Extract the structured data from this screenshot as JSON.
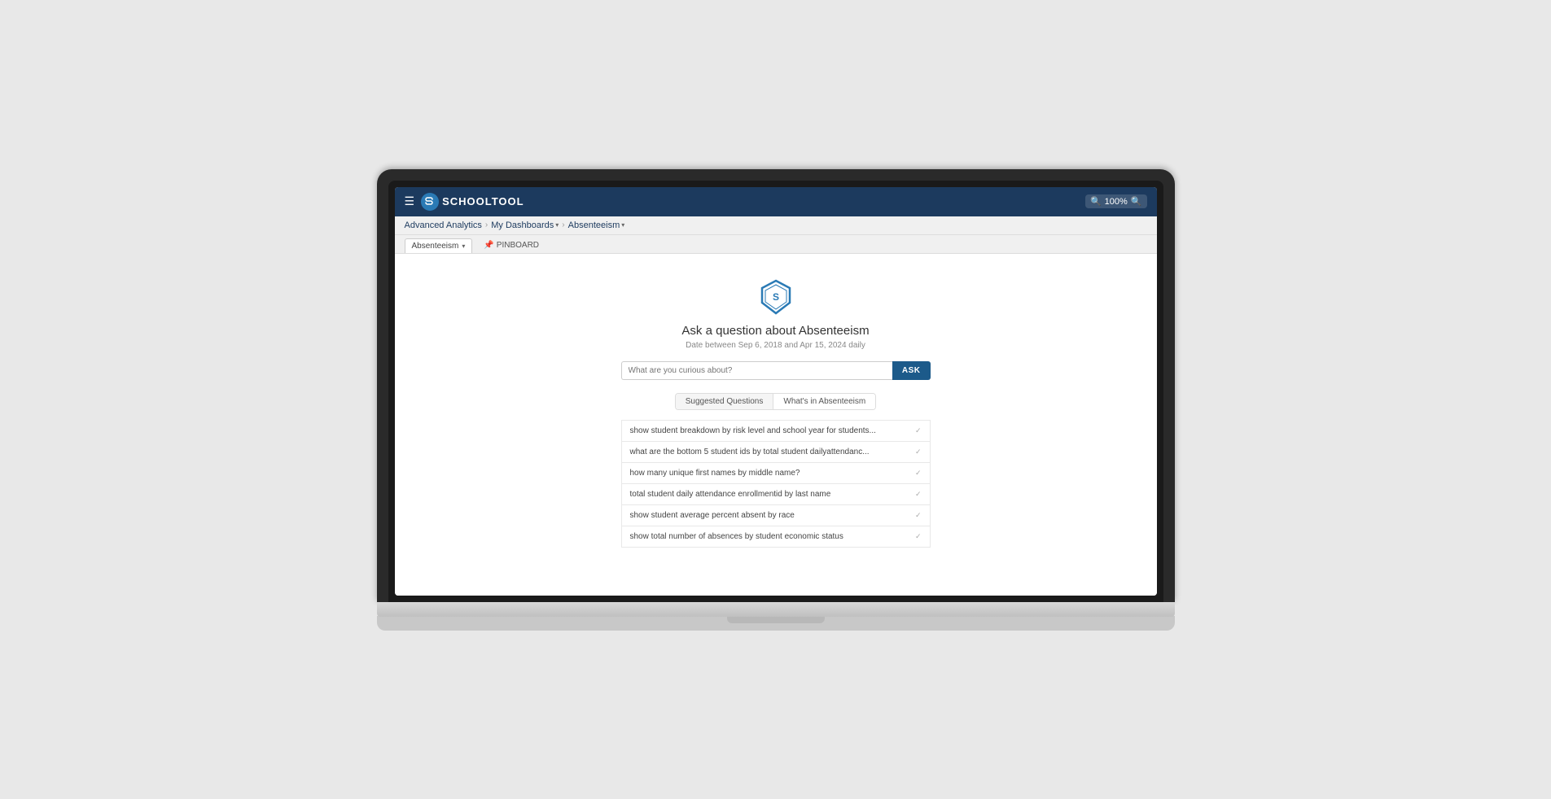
{
  "topbar": {
    "logo_letter": "S",
    "logo_text": "SCHOOLTOOL",
    "zoom_label": "100%"
  },
  "breadcrumb": {
    "item1": "Advanced Analytics",
    "item2": "My Dashboards",
    "item3": "Absenteeism"
  },
  "tab": {
    "label": "Absenteeism",
    "pinboard": "PINBOARD"
  },
  "main": {
    "ask_title": "Ask a question about Absenteeism",
    "ask_subtitle": "Date between Sep 6, 2018 and Apr 15, 2024 daily",
    "search_placeholder": "What are you curious about?",
    "ask_button": "ASK",
    "tab_suggested": "Suggested Questions",
    "tab_whats_in": "What's in Absenteeism",
    "suggestions": [
      {
        "text": "show student breakdown by risk level and school year for students...",
        "checked": true
      },
      {
        "text": "what are the bottom 5 student ids by total student dailyattendanc...",
        "checked": true
      },
      {
        "text": "how many unique first names by middle name?",
        "checked": true
      },
      {
        "text": "total student daily attendance enrollmentid by last name",
        "checked": true
      },
      {
        "text": "show student average percent absent by race",
        "checked": true
      },
      {
        "text": "show total number of absences by student economic status",
        "checked": true
      }
    ]
  },
  "colors": {
    "topbar_bg": "#1c3a5e",
    "ask_btn_bg": "#1c5a8a",
    "hex_stroke": "#2a7ab5"
  }
}
